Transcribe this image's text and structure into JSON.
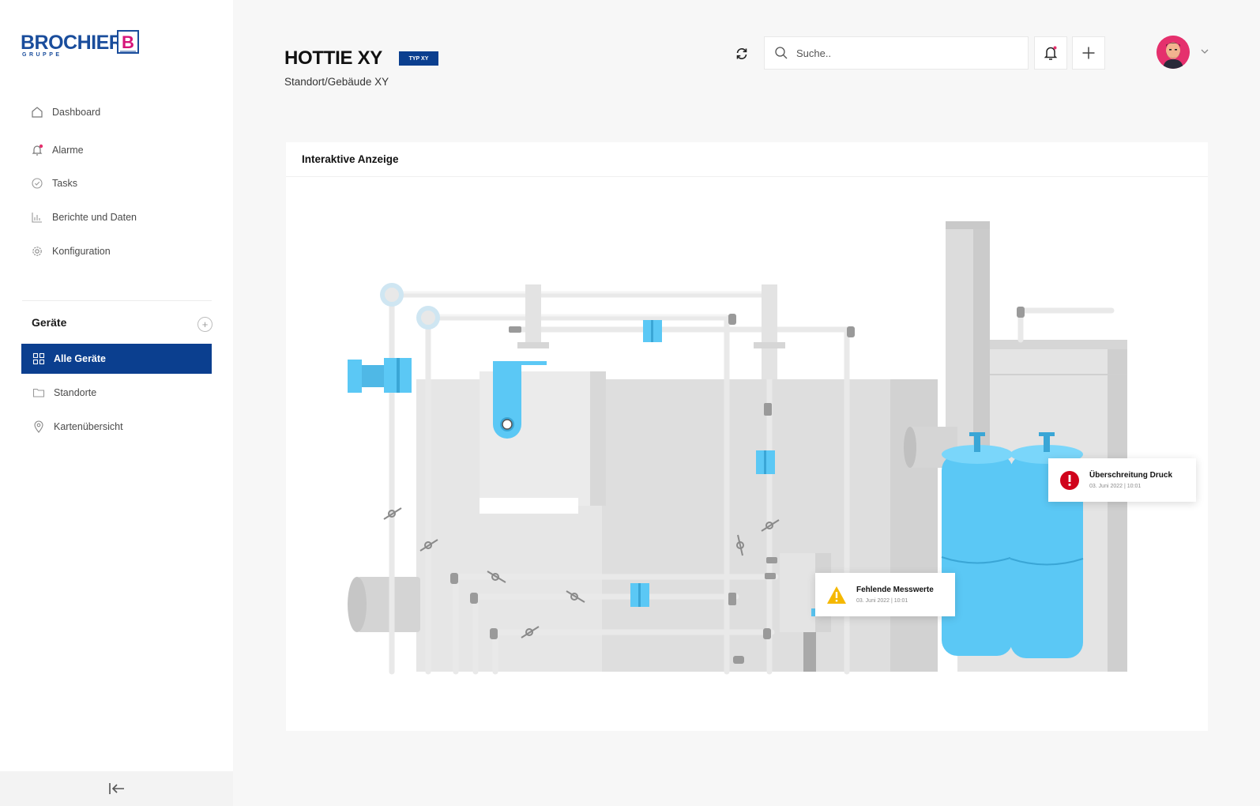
{
  "brand": {
    "name": "BROCHIER",
    "sub": "GRUPPE",
    "mark": "B"
  },
  "nav": [
    {
      "label": "Dashboard",
      "icon": "home-icon"
    },
    {
      "label": "Alarme",
      "icon": "bell-icon"
    },
    {
      "label": "Tasks",
      "icon": "check-circle-icon"
    },
    {
      "label": "Berichte und Daten",
      "icon": "bar-chart-icon"
    },
    {
      "label": "Konfiguration",
      "icon": "gear-icon"
    }
  ],
  "devices": {
    "title": "Geräte",
    "items": [
      {
        "label": "Alle Geräte",
        "icon": "grid-icon",
        "active": true
      },
      {
        "label": "Standorte",
        "icon": "folder-icon",
        "active": false
      },
      {
        "label": "Kartenübersicht",
        "icon": "map-pin-icon",
        "active": false
      }
    ]
  },
  "header": {
    "title": "HOTTIE XY",
    "badge": "TYP XY",
    "subtitle": "Standort/Gebäude XY",
    "search_placeholder": "Suche.."
  },
  "card": {
    "title": "Interaktive Anzeige"
  },
  "alerts": [
    {
      "title": "Überschreitung Druck",
      "date": "03. Juni 2022 | 10:01",
      "severity": "error",
      "color": "#d0021b"
    },
    {
      "title": "Fehlende Messwerte",
      "date": "03. Juni 2022 | 10:01",
      "severity": "warning",
      "color": "#f5b800"
    }
  ],
  "colors": {
    "primary": "#0b3f8f",
    "accent_blue": "#5bc8f5",
    "alarm_dot": "#e5306d"
  }
}
